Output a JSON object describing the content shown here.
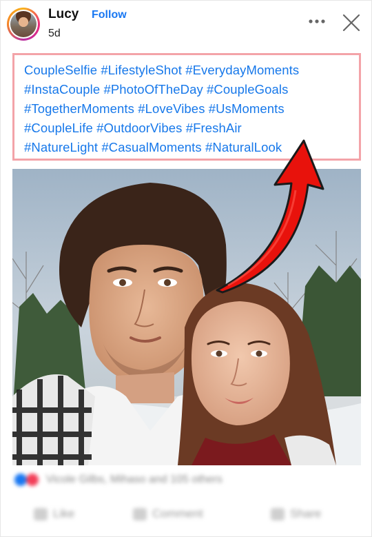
{
  "post": {
    "author": "Lucy",
    "follow_label": "Follow",
    "time": "5d",
    "more_icon": "more-horizontal-icon",
    "close_icon": "close-icon"
  },
  "hashtags": {
    "lines": [
      "CoupleSelfie #LifestyleShot #EverydayMoments",
      "#InstaCouple #PhotoOfTheDay #CoupleGoals",
      "#TogetherMoments #LoveVibes #UsMoments",
      "#CoupleLife #OutdoorVibes #FreshAir",
      "#NatureLight #CasualMoments #NaturalLook"
    ],
    "text_color": "#1778ea",
    "border_color": "#f3a3a8"
  },
  "annotation": {
    "arrow_color": "#e8120c"
  },
  "footer": {
    "reactions_text": "Vicole Gilbs, Mihaso and 105 others",
    "actions": [
      {
        "label": "Like",
        "icon": "like-icon"
      },
      {
        "label": "Comment",
        "icon": "comment-icon"
      },
      {
        "label": "Share",
        "icon": "share-icon"
      }
    ]
  }
}
